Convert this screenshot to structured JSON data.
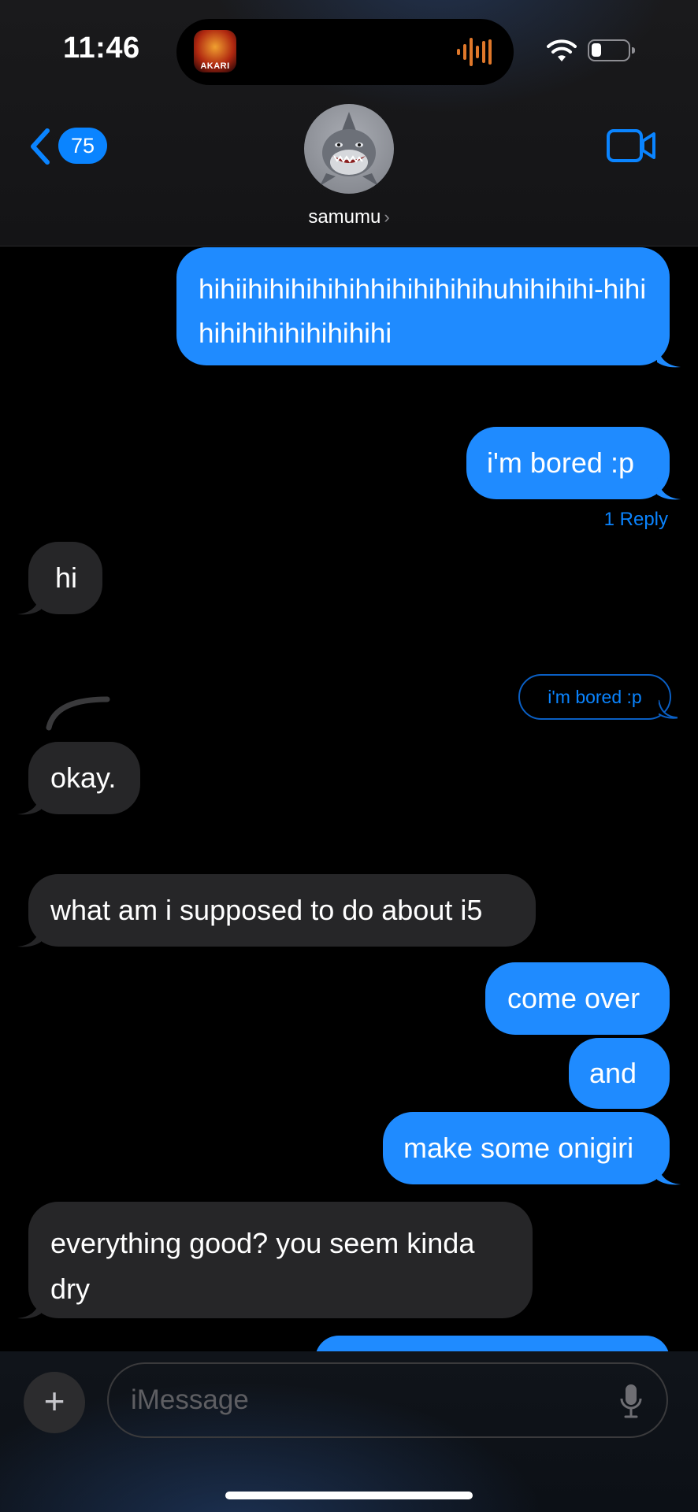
{
  "status_bar": {
    "time": "11:46",
    "live_activity_app": "AKARI",
    "icons": [
      "wifi-icon",
      "battery-icon",
      "audio-wave-icon"
    ]
  },
  "header": {
    "back_count": "75",
    "contact_name": "samumu",
    "chevron": "›",
    "icons": [
      "chevron-left-icon",
      "video-camera-icon",
      "shark-avatar"
    ]
  },
  "messages": [
    {
      "direction": "sent",
      "text": "hihiihihihihihihhihihihihihuhihihihi-hihihihihihihihihihihi"
    },
    {
      "direction": "sent",
      "text": "i'm bored :p"
    },
    {
      "direction": "received",
      "text": "hi"
    },
    {
      "direction": "received",
      "text": "okay."
    },
    {
      "direction": "received",
      "text": "what am i supposed to do about i5"
    },
    {
      "direction": "sent",
      "text": "come over"
    },
    {
      "direction": "sent",
      "text": "and"
    },
    {
      "direction": "sent",
      "text": "make some onigiri"
    },
    {
      "direction": "received",
      "text": "everything good? you seem kinda dry"
    }
  ],
  "reply_count": "1 Reply",
  "reply_preview": "i'm bored :p",
  "input": {
    "placeholder": "iMessage",
    "plus": "+",
    "icons": [
      "plus-icon",
      "microphone-icon"
    ]
  },
  "colors": {
    "sent_bubble": "#1f8bff",
    "received_bubble": "#262628",
    "accent": "#0a84ff"
  }
}
